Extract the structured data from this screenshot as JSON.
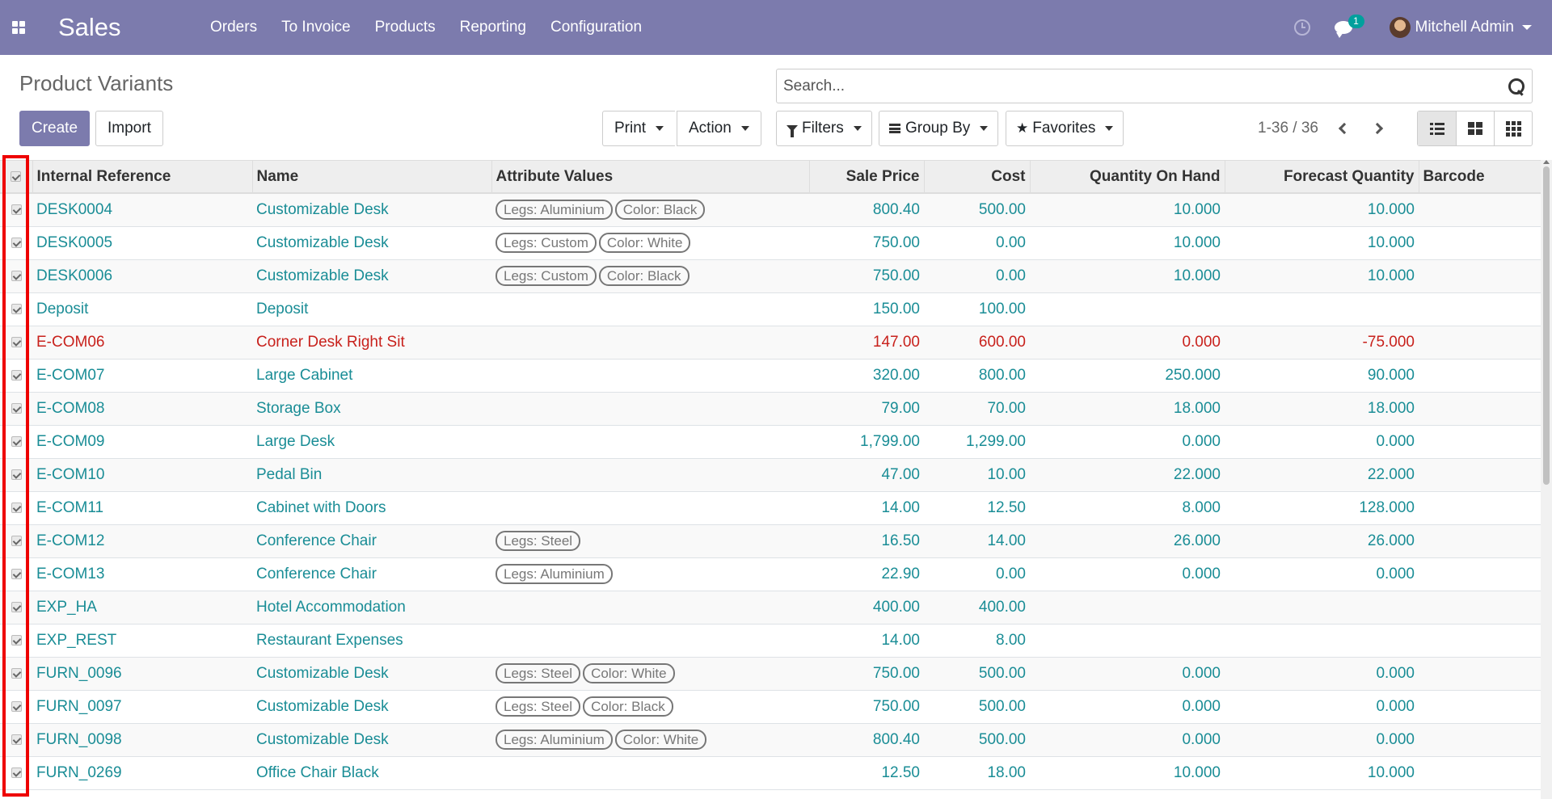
{
  "navbar": {
    "brand": "Sales",
    "menu": [
      "Orders",
      "To Invoice",
      "Products",
      "Reporting",
      "Configuration"
    ],
    "chat_count": "1",
    "user_name": "Mitchell Admin"
  },
  "control_panel": {
    "title": "Product Variants",
    "search_placeholder": "Search...",
    "create_label": "Create",
    "import_label": "Import",
    "print_label": "Print",
    "action_label": "Action",
    "filters_label": "Filters",
    "group_by_label": "Group By",
    "favorites_label": "Favorites",
    "pager": "1-36 / 36"
  },
  "table": {
    "columns": [
      "Internal Reference",
      "Name",
      "Attribute Values",
      "Sale Price",
      "Cost",
      "Quantity On Hand",
      "Forecast Quantity",
      "Barcode"
    ],
    "rows": [
      {
        "ref": "DESK0004",
        "name": "Customizable Desk",
        "tags": [
          "Legs: Aluminium",
          "Color: Black"
        ],
        "sale": "800.40",
        "cost": "500.00",
        "qty": "10.000",
        "forecast": "10.000",
        "barcode": ""
      },
      {
        "ref": "DESK0005",
        "name": "Customizable Desk",
        "tags": [
          "Legs: Custom",
          "Color: White"
        ],
        "sale": "750.00",
        "cost": "0.00",
        "qty": "10.000",
        "forecast": "10.000",
        "barcode": ""
      },
      {
        "ref": "DESK0006",
        "name": "Customizable Desk",
        "tags": [
          "Legs: Custom",
          "Color: Black"
        ],
        "sale": "750.00",
        "cost": "0.00",
        "qty": "10.000",
        "forecast": "10.000",
        "barcode": ""
      },
      {
        "ref": "Deposit",
        "name": "Deposit",
        "tags": [],
        "sale": "150.00",
        "cost": "100.00",
        "qty": "",
        "forecast": "",
        "barcode": ""
      },
      {
        "ref": "E-COM06",
        "name": "Corner Desk Right Sit",
        "tags": [],
        "sale": "147.00",
        "cost": "600.00",
        "qty": "0.000",
        "forecast": "-75.000",
        "barcode": "",
        "danger": true
      },
      {
        "ref": "E-COM07",
        "name": "Large Cabinet",
        "tags": [],
        "sale": "320.00",
        "cost": "800.00",
        "qty": "250.000",
        "forecast": "90.000",
        "barcode": ""
      },
      {
        "ref": "E-COM08",
        "name": "Storage Box",
        "tags": [],
        "sale": "79.00",
        "cost": "70.00",
        "qty": "18.000",
        "forecast": "18.000",
        "barcode": ""
      },
      {
        "ref": "E-COM09",
        "name": "Large Desk",
        "tags": [],
        "sale": "1,799.00",
        "cost": "1,299.00",
        "qty": "0.000",
        "forecast": "0.000",
        "barcode": ""
      },
      {
        "ref": "E-COM10",
        "name": "Pedal Bin",
        "tags": [],
        "sale": "47.00",
        "cost": "10.00",
        "qty": "22.000",
        "forecast": "22.000",
        "barcode": ""
      },
      {
        "ref": "E-COM11",
        "name": "Cabinet with Doors",
        "tags": [],
        "sale": "14.00",
        "cost": "12.50",
        "qty": "8.000",
        "forecast": "128.000",
        "barcode": ""
      },
      {
        "ref": "E-COM12",
        "name": "Conference Chair",
        "tags": [
          "Legs: Steel"
        ],
        "sale": "16.50",
        "cost": "14.00",
        "qty": "26.000",
        "forecast": "26.000",
        "barcode": ""
      },
      {
        "ref": "E-COM13",
        "name": "Conference Chair",
        "tags": [
          "Legs: Aluminium"
        ],
        "sale": "22.90",
        "cost": "0.00",
        "qty": "0.000",
        "forecast": "0.000",
        "barcode": ""
      },
      {
        "ref": "EXP_HA",
        "name": "Hotel Accommodation",
        "tags": [],
        "sale": "400.00",
        "cost": "400.00",
        "qty": "",
        "forecast": "",
        "barcode": ""
      },
      {
        "ref": "EXP_REST",
        "name": "Restaurant Expenses",
        "tags": [],
        "sale": "14.00",
        "cost": "8.00",
        "qty": "",
        "forecast": "",
        "barcode": ""
      },
      {
        "ref": "FURN_0096",
        "name": "Customizable Desk",
        "tags": [
          "Legs: Steel",
          "Color: White"
        ],
        "sale": "750.00",
        "cost": "500.00",
        "qty": "0.000",
        "forecast": "0.000",
        "barcode": ""
      },
      {
        "ref": "FURN_0097",
        "name": "Customizable Desk",
        "tags": [
          "Legs: Steel",
          "Color: Black"
        ],
        "sale": "750.00",
        "cost": "500.00",
        "qty": "0.000",
        "forecast": "0.000",
        "barcode": ""
      },
      {
        "ref": "FURN_0098",
        "name": "Customizable Desk",
        "tags": [
          "Legs: Aluminium",
          "Color: White"
        ],
        "sale": "800.40",
        "cost": "500.00",
        "qty": "0.000",
        "forecast": "0.000",
        "barcode": ""
      },
      {
        "ref": "FURN_0269",
        "name": "Office Chair Black",
        "tags": [],
        "sale": "12.50",
        "cost": "18.00",
        "qty": "10.000",
        "forecast": "10.000",
        "barcode": ""
      }
    ]
  },
  "colors": {
    "navbar": "#7c7bad",
    "link": "#1a8d96",
    "danger": "#c8211c",
    "highlight": "#ee0000"
  }
}
